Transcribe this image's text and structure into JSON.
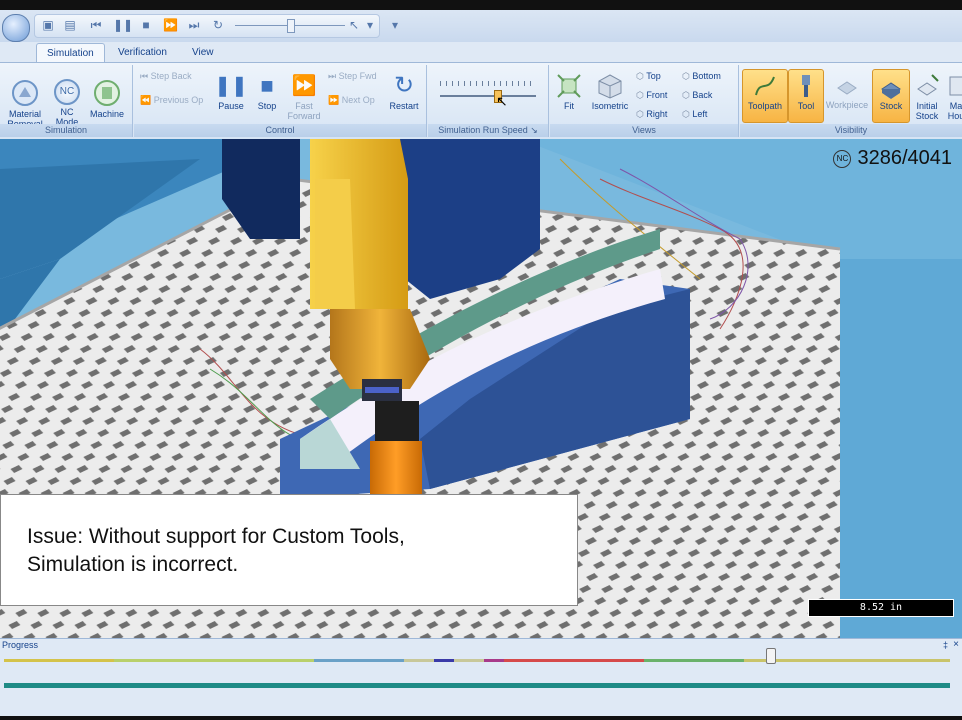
{
  "tabs": [
    "Simulation",
    "Verification",
    "View"
  ],
  "active_tab": "Simulation",
  "ribbon": {
    "simulation_group": {
      "label": "Simulation",
      "material_removal": "Material\nRemoval",
      "nc_mode": "NC\nMode",
      "machine": "Machine"
    },
    "control_group": {
      "label": "Control",
      "step_back": "Step Back",
      "previous_op": "Previous Op",
      "pause": "Pause",
      "stop": "Stop",
      "fast_forward": "Fast\nForward",
      "step_fwd": "Step Fwd",
      "next_op": "Next Op",
      "restart": "Restart"
    },
    "speed_group": {
      "label": "Simulation Run Speed",
      "speed_level": 0.59
    },
    "views_group": {
      "label": "Views",
      "fit": "Fit",
      "isometric": "Isometric",
      "top": "Top",
      "front": "Front",
      "right": "Right",
      "bottom": "Bottom",
      "back": "Back",
      "left": "Left"
    },
    "visibility_group": {
      "label": "Visibility",
      "toolpath": "Toolpath",
      "tool": "Tool",
      "workpiece": "Workpiece",
      "stock": "Stock",
      "initial_stock": "Initial\nStock",
      "machine_housing": "Ma\nHou"
    }
  },
  "viewport": {
    "nc_badge": "NC",
    "counter": "3286/4041",
    "issue_line1": "Issue:  Without support for Custom Tools,",
    "issue_line2": "Simulation is incorrect.",
    "scale_value": "8.52 in"
  },
  "progress": {
    "title": "Progress",
    "pin": "‡",
    "close": "×",
    "position": 0.81
  },
  "colors": {
    "ribbon_highlight": "#f7b444",
    "machine_blue": "#1c3f86",
    "tool_yellow": "#f2c02a",
    "tool_orange": "#f08a10",
    "progress_teal": "#1f8b86"
  }
}
